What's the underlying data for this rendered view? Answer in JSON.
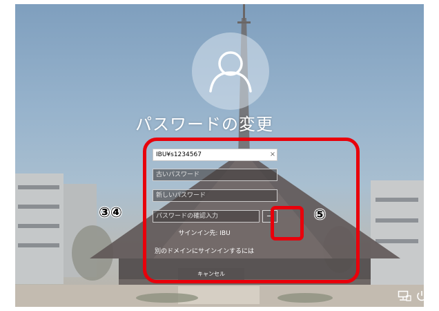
{
  "title": "パスワードの変更",
  "form": {
    "username_value": "IBU¥s1234567",
    "clear_icon": "×",
    "old_password_placeholder": "古いパスワード",
    "new_password_placeholder": "新しいパスワード",
    "confirm_password_placeholder": "パスワードの確認入力",
    "submit_arrow": "→",
    "signin_to": "サインイン先: IBU",
    "other_domain_link": "別のドメインにサインインするには",
    "cancel_label": "キャンセル"
  },
  "annotations": {
    "label_fields": "③④",
    "label_submit": "⑤",
    "color": "#e8000b"
  },
  "icons": {
    "avatar": "user-avatar-icon",
    "network": "network-icon",
    "power": "power-icon"
  }
}
